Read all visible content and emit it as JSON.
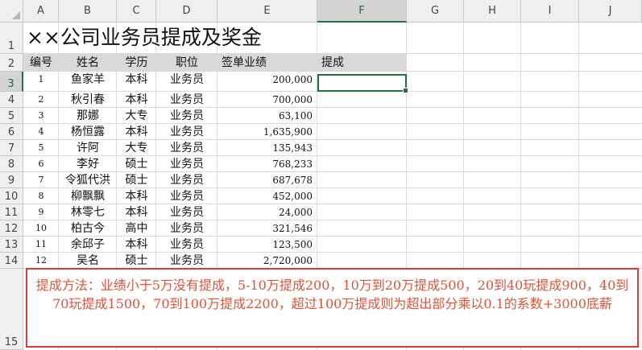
{
  "columns": [
    "A",
    "B",
    "C",
    "D",
    "E",
    "F",
    "G",
    "H",
    "I",
    "J"
  ],
  "active_column": "F",
  "rows": [
    "1",
    "2",
    "3",
    "4",
    "5",
    "6",
    "7",
    "8",
    "9",
    "10",
    "11",
    "12",
    "13",
    "14",
    "15"
  ],
  "active_row": "3",
  "title": "××公司业务员提成及奖金",
  "headers": {
    "a": "编号",
    "b": "姓名",
    "c": "学历",
    "d": "职位",
    "e": "签单业绩",
    "f": "提成"
  },
  "records": [
    {
      "id": "1",
      "name": "鱼家羊",
      "edu": "本科",
      "pos": "业务员",
      "amount": "200,000"
    },
    {
      "id": "2",
      "name": "秋引春",
      "edu": "本科",
      "pos": "业务员",
      "amount": "700,000"
    },
    {
      "id": "3",
      "name": "那娜",
      "edu": "大专",
      "pos": "业务员",
      "amount": "63,100"
    },
    {
      "id": "4",
      "name": "杨恒露",
      "edu": "本科",
      "pos": "业务员",
      "amount": "1,635,900"
    },
    {
      "id": "5",
      "name": "许阿",
      "edu": "大专",
      "pos": "业务员",
      "amount": "135,943"
    },
    {
      "id": "6",
      "name": "李好",
      "edu": "硕士",
      "pos": "业务员",
      "amount": "768,233"
    },
    {
      "id": "7",
      "name": "令狐代洪",
      "edu": "硕士",
      "pos": "业务员",
      "amount": "687,678"
    },
    {
      "id": "8",
      "name": "柳飘飘",
      "edu": "本科",
      "pos": "业务员",
      "amount": "452,000"
    },
    {
      "id": "9",
      "name": "林零七",
      "edu": "本科",
      "pos": "业务员",
      "amount": "24,000"
    },
    {
      "id": "10",
      "name": "柏古今",
      "edu": "高中",
      "pos": "业务员",
      "amount": "321,546"
    },
    {
      "id": "11",
      "name": "余邱子",
      "edu": "本科",
      "pos": "业务员",
      "amount": "123,500"
    },
    {
      "id": "12",
      "name": "吴名",
      "edu": "硕士",
      "pos": "业务员",
      "amount": "2,720,000"
    }
  ],
  "note": "提成方法：业绩小于5万没有提成，5-10万提成200，10万到20万提成500，20到40玩提成900，40到70玩提成1500，70到100万提成2200，超过100万提成则为超出部分乘以0.1的系数+3000底薪",
  "colors": {
    "selection": "#217346",
    "note_border": "#e03a3a",
    "note_text": "#e0533a",
    "header_band": "#d9d9d9"
  }
}
